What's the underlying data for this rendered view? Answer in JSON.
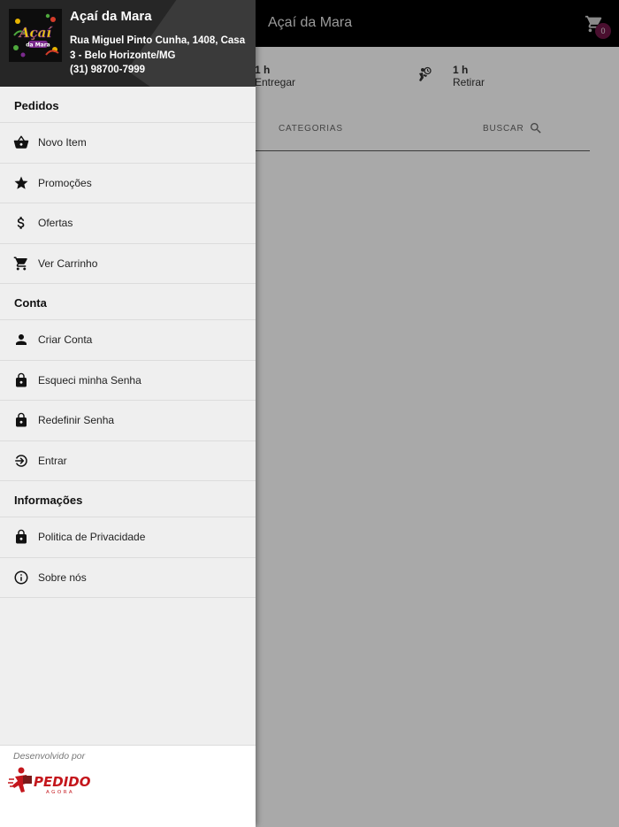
{
  "app": {
    "title": "Açaí da Mara",
    "cart_count": "0"
  },
  "delivery": {
    "deliver_time": "1 h",
    "deliver_label": "Entregar",
    "pickup_time": "1 h",
    "pickup_label": "Retirar"
  },
  "tabs": {
    "categories": "CATEGORIAS",
    "search": "BUSCAR"
  },
  "store": {
    "name": "Açaí da Mara",
    "address": "Rua Miguel Pinto Cunha, 1408, Casa 3 - Belo Horizonte/MG",
    "phone": "(31) 98700-7999",
    "logo_text_top": "Açaí",
    "logo_text_bottom": "da Mara"
  },
  "menu": {
    "orders_header": "Pedidos",
    "orders": [
      {
        "label": "Novo Item",
        "icon": "basket-icon"
      },
      {
        "label": "Promoções",
        "icon": "star-icon"
      },
      {
        "label": "Ofertas",
        "icon": "dollar-icon"
      },
      {
        "label": "Ver Carrinho",
        "icon": "cart-icon"
      }
    ],
    "account_header": "Conta",
    "account": [
      {
        "label": "Criar Conta",
        "icon": "person-icon"
      },
      {
        "label": "Esqueci minha Senha",
        "icon": "lock-icon"
      },
      {
        "label": "Redefinir Senha",
        "icon": "lock-icon"
      },
      {
        "label": "Entrar",
        "icon": "login-icon"
      }
    ],
    "info_header": "Informações",
    "info": [
      {
        "label": "Politica de Privacidade",
        "icon": "lock-icon"
      },
      {
        "label": "Sobre nós",
        "icon": "info-icon"
      }
    ]
  },
  "footer": {
    "developed_by": "Desenvolvido por",
    "brand_top": "PEDIDO",
    "brand_bottom": "AGORA"
  },
  "colors": {
    "app_bar": "#000000",
    "overlay": "#a9a9a9",
    "drawer_bg": "#efefef",
    "badge": "#4a0f2f",
    "brand_red": "#c4161c"
  }
}
